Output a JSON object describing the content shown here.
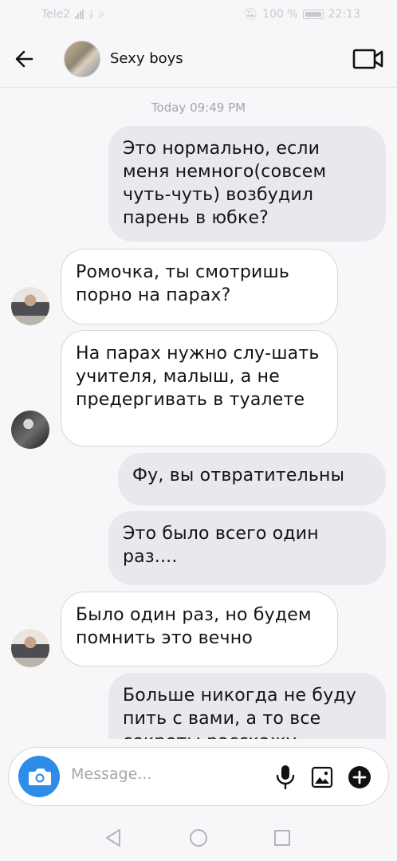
{
  "status_bar": {
    "carrier": "Tele2",
    "battery": "100 %",
    "time": "22:13"
  },
  "header": {
    "title": "Sexy boys"
  },
  "chat": {
    "timestamp": "Today 09:49 PM",
    "messages": [
      {
        "direction": "outgoing",
        "text": "Это нормально, если меня немного(совсем чуть-чуть) возбудил парень в юбке?"
      },
      {
        "direction": "incoming",
        "text": "Ромочка, ты смотришь порно на парах?"
      },
      {
        "direction": "incoming",
        "text": "На парах нужно слу-шать учителя, малыш, а не предергивать в туалете"
      },
      {
        "direction": "outgoing",
        "text": "Фу, вы отвратительны"
      },
      {
        "direction": "outgoing",
        "text": "Это было всего один раз...."
      },
      {
        "direction": "incoming",
        "text": "Было один раз, но будем помнить это вечно"
      },
      {
        "direction": "outgoing",
        "text": "Больше никогда не буду пить с вами, а то все секреты расскажу"
      }
    ]
  },
  "composer": {
    "placeholder": "Message..."
  },
  "colors": {
    "accent": "#2d8ce8",
    "outgoing_bubble": "#e8e8ed",
    "incoming_bubble": "#ffffff",
    "background": "#f7f7f9"
  },
  "icons": [
    "back-arrow-icon",
    "group-avatar",
    "video-call-icon",
    "camera-icon",
    "microphone-icon",
    "gallery-icon",
    "plus-icon",
    "nav-back-icon",
    "nav-home-icon",
    "nav-recents-icon"
  ]
}
